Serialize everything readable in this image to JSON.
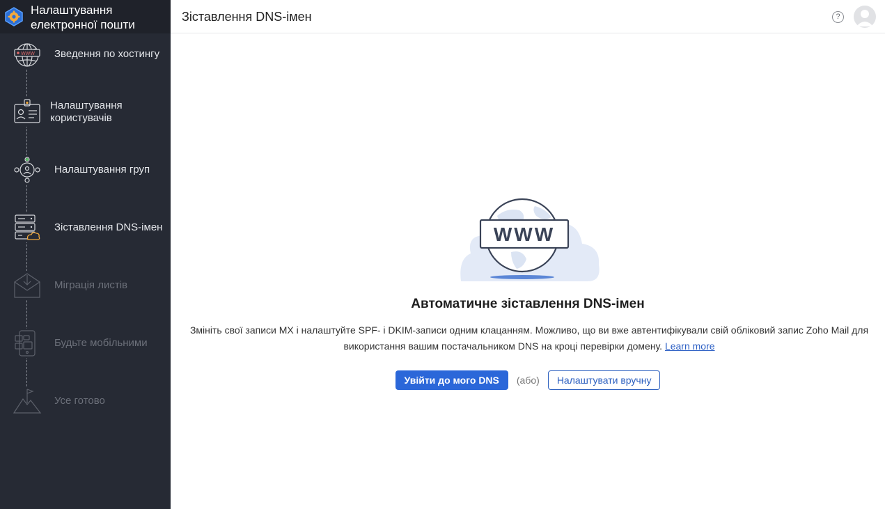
{
  "sidebar": {
    "title": "Налаштування електронної пошти",
    "steps": [
      {
        "label": "Зведення по хостингу",
        "icon": "globe-www-icon",
        "state": "done"
      },
      {
        "label": "Налаштування користувачів",
        "icon": "user-card-icon",
        "state": "done"
      },
      {
        "label": "Налаштування груп",
        "icon": "group-icon",
        "state": "done"
      },
      {
        "label": "Зіставлення DNS-імен",
        "icon": "server-cloud-icon",
        "state": "current"
      },
      {
        "label": "Міграція листів",
        "icon": "mail-download-icon",
        "state": "pending"
      },
      {
        "label": "Будьте мобільними",
        "icon": "mobile-icon",
        "state": "pending"
      },
      {
        "label": "Усе готово",
        "icon": "mountain-flag-icon",
        "state": "pending"
      }
    ]
  },
  "header": {
    "title": "Зіставлення DNS-імен",
    "help_symbol": "?"
  },
  "main": {
    "illustration_text": "WWW",
    "heading": "Автоматичне зіставлення DNS-імен",
    "description_line1": "Змініть свої записи MX і налаштуйте SPF- і DKIM-записи одним клацанням. Можливо, що ви вже автентифікували свій обліковий запис Zoho Mail для",
    "description_line2": "використання вашим постачальником DNS на кроці перевірки домену.",
    "learn_more": "Learn more",
    "primary_button": "Увійти до мого DNS",
    "or_text": "(або)",
    "secondary_button": "Налаштувати вручну"
  },
  "colors": {
    "sidebar_bg": "#262a34",
    "brand_bg": "#1f222a",
    "primary": "#2b67d9",
    "link": "#2c5fc4"
  }
}
